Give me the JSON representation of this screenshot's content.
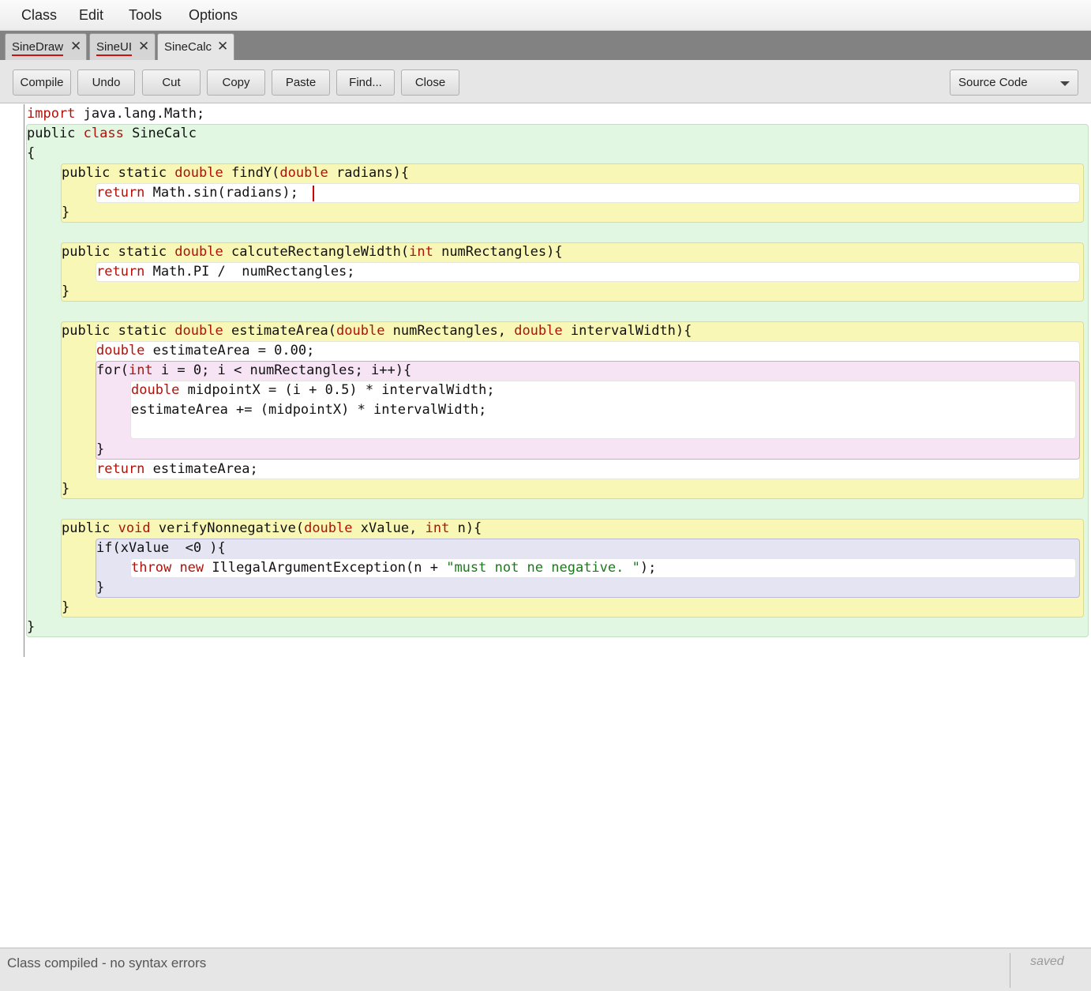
{
  "menu": [
    "Class",
    "Edit",
    "Tools",
    "Options"
  ],
  "tabs": [
    {
      "label": "SineDraw",
      "has_error": true,
      "active": false
    },
    {
      "label": "SineUI",
      "has_error": true,
      "active": false
    },
    {
      "label": "SineCalc",
      "has_error": false,
      "active": true
    }
  ],
  "toolbar": {
    "buttons": [
      "Compile",
      "Undo",
      "Cut",
      "Copy",
      "Paste",
      "Find...",
      "Close"
    ],
    "view_select": "Source Code"
  },
  "code": {
    "lines": [
      [
        [
          "kw",
          "import"
        ],
        [
          "t",
          " java.lang.Math;"
        ]
      ],
      [
        [
          "t",
          "public "
        ],
        [
          "kw",
          "class"
        ],
        [
          "t",
          " SineCalc"
        ]
      ],
      [
        [
          "t",
          "{"
        ]
      ],
      [
        [
          "t",
          "public static "
        ],
        [
          "kw",
          "double"
        ],
        [
          "t",
          " findY("
        ],
        [
          "kw",
          "double"
        ],
        [
          "t",
          " radians){"
        ]
      ],
      [
        [
          "kw",
          "return"
        ],
        [
          "t",
          " Math.sin(radians);"
        ]
      ],
      [
        [
          "t",
          "}"
        ]
      ],
      [
        [
          "t",
          "public static "
        ],
        [
          "kw",
          "double"
        ],
        [
          "t",
          " calcuteRectangleWidth("
        ],
        [
          "kw",
          "int"
        ],
        [
          "t",
          " numRectangles){"
        ]
      ],
      [
        [
          "kw",
          "return"
        ],
        [
          "t",
          " Math.PI /  numRectangles;"
        ]
      ],
      [
        [
          "t",
          "}"
        ]
      ],
      [
        [
          "t",
          "public static "
        ],
        [
          "kw",
          "double"
        ],
        [
          "t",
          " estimateArea("
        ],
        [
          "kw",
          "double"
        ],
        [
          "t",
          " numRectangles, "
        ],
        [
          "kw",
          "double"
        ],
        [
          "t",
          " intervalWidth){"
        ]
      ],
      [
        [
          "kw",
          "double"
        ],
        [
          "t",
          " estimateArea = 0.00;"
        ]
      ],
      [
        [
          "t",
          "for("
        ],
        [
          "kw",
          "int"
        ],
        [
          "t",
          " i = 0; i < numRectangles; i++){"
        ]
      ],
      [
        [
          "kw",
          "double"
        ],
        [
          "t",
          " midpointX = (i + 0.5) * intervalWidth;"
        ]
      ],
      [
        [
          "t",
          "estimateArea += (midpointX) * intervalWidth;"
        ]
      ],
      [
        [
          "t",
          "}"
        ]
      ],
      [
        [
          "kw",
          "return"
        ],
        [
          "t",
          " estimateArea;"
        ]
      ],
      [
        [
          "t",
          "}"
        ]
      ],
      [
        [
          "t",
          "public "
        ],
        [
          "kw",
          "void"
        ],
        [
          "t",
          " verifyNonnegative("
        ],
        [
          "kw",
          "double"
        ],
        [
          "t",
          " xValue, "
        ],
        [
          "kw",
          "int"
        ],
        [
          "t",
          " n){"
        ]
      ],
      [
        [
          "t",
          "if(xValue  <0 ){"
        ]
      ],
      [
        [
          "kw",
          "throw"
        ],
        [
          "t",
          " "
        ],
        [
          "kw",
          "new"
        ],
        [
          "t",
          " IllegalArgumentException(n + "
        ],
        [
          "str",
          "\"must not ne negative. \""
        ],
        [
          "t",
          ");"
        ]
      ],
      [
        [
          "t",
          "}"
        ]
      ],
      [
        [
          "t",
          "}"
        ]
      ],
      [
        [
          "t",
          "}"
        ]
      ]
    ]
  },
  "status": {
    "message": "Class compiled - no syntax errors",
    "saved": "saved"
  },
  "colors": {
    "keyword": "#b0120a",
    "string": "#1a7a1a",
    "class_scope": "#e2f7e1",
    "method_scope": "#f8f7b6",
    "for_scope": "#f6e4f5",
    "if_scope": "#e4e4f2",
    "error_underline": "#cc1111"
  }
}
